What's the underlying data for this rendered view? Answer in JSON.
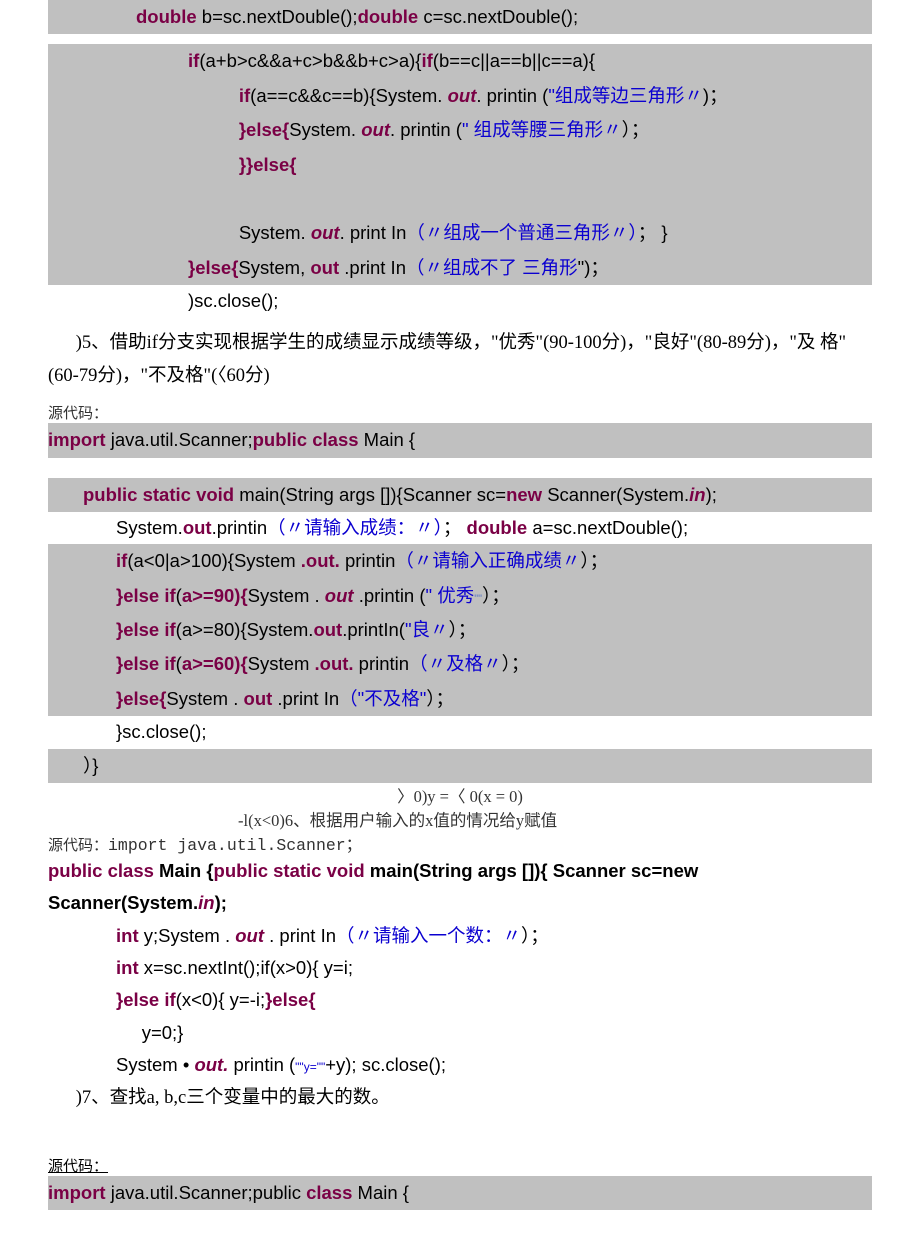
{
  "b1": {
    "l1_a": "double ",
    "l1_b": "b=sc.nextDouble();",
    "l1_c": "double ",
    "l1_d": "c=sc.nextDouble();",
    "l2_a": "if",
    "l2_b": "(a+b>c&&a+c>b&&b+c>a){",
    "l2_c": "if",
    "l2_d": "(b==c||a==b||c==a){",
    "l3_a": "if",
    "l3_b": "(a==c&&c==b){System. ",
    "l3_c": "out",
    "l3_d": ". printin (",
    "l3_e": "\"组成等边三角形〃",
    "l3_f": ")；",
    "l4_a": "}else{",
    "l4_b": "System. ",
    "l4_c": "out",
    "l4_d": ". printin (",
    "l4_e": "\" 组成等腰三角形〃",
    "l4_f": "）；",
    "l5": "}}",
    "l5b": "else{",
    "l6_a": "System. ",
    "l6_b": "out",
    "l6_c": ". print In",
    "l6_d": "（〃组成一个普通三角形〃）",
    "l6_e": "；  }",
    "l7_a": "}else{",
    "l7_b": "System, ",
    "l7_c": "out ",
    "l7_d": ".print In",
    "l7_e": "（〃组成不了  三角形",
    "l7_f": "\")；",
    "l8": ")sc.close();"
  },
  "p5": "      )5、借助if分支实现根据学生的成绩显示成绩等级，\"优秀\"(90-100分)，\"良好\"(80-89分)，\"及 格\"(60-79分)，\"不及格\"(〈60分)",
  "src": "源代码：",
  "b2": {
    "l1_a": "import ",
    "l1_b": "java.util.Scanner;",
    "l1_c": "public class ",
    "l1_d": "Main {",
    "l2_a": "public static void ",
    "l2_b": "main(String args []){Scanner ",
    "l2_c": "sc",
    "l2_d": "=",
    "l2_e": "new ",
    "l2_f": "Scanner(System.",
    "l2_g": "in",
    "l2_h": ");",
    "l3_a": "System.",
    "l3_b": "out",
    "l3_c": ".printin",
    "l3_d": "（〃请输入成绩：〃）",
    "l3_e": "；  ",
    "l3_f": "double ",
    "l3_g": "a=sc.nextDouble();",
    "l4_a": "if",
    "l4_b": "(a<0|a>100){System ",
    "l4_c": ".out.",
    "l4_d": " printin",
    "l4_e": "（〃请输入正确成绩〃",
    "l4_f": "）；",
    "l5_a": "}else if",
    "l5_b": "(",
    "l5_c": "a>=90){",
    "l5_d": "System . ",
    "l5_e": "out ",
    "l5_f": ".printin (",
    "l5_g": "\" 优秀",
    "l5_h": "\"\"",
    "l5_i": "）；",
    "l6_a": "}else if",
    "l6_b": "(a>=80){System.",
    "l6_c": "out",
    "l6_d": ".printIn(",
    "l6_e": "\"良〃",
    "l6_f": "）；",
    "l7_a": "}else if",
    "l7_b": "(",
    "l7_c": "a>=60){",
    "l7_d": "System ",
    "l7_e": ".out.",
    "l7_f": " printin",
    "l7_g": "（〃及格〃",
    "l7_h": "）；",
    "l8_a": "}else{",
    "l8_b": "System . ",
    "l8_c": "out ",
    "l8_d": ".print In",
    "l8_e": "（\"不及格\"",
    "l8_f": "）；",
    "l9": "}sc.close();",
    "l10": "）}"
  },
  "mid1": "〉0)y =〈 0(x = 0)",
  "mid2": "-l(x<0)6、根据用户输入的x值的情况给y赋值",
  "src2": "源代码：",
  "imp2": "import  java.util.Scanner；",
  "b3": {
    "l1_a": "public class ",
    "l1_b": "Main {",
    "l1_c": "public static void ",
    "l1_d": "main(String args []){ Scanner sc=new Scanner(System.",
    "l1_e": "in",
    "l1_f": ");",
    "l2_a": "int ",
    "l2_b": "y;System . ",
    "l2_c": "out",
    "l2_d": " . print In",
    "l2_e": "（〃请输入一个数：〃",
    "l2_f": "）；",
    "l3_a": "int ",
    "l3_b": "x=sc.nextInt();if(x>0){ y=i;",
    "l4_a": "}else if",
    "l4_b": "(x<0){ y=-i;",
    "l4_c": "}else{",
    "l5": "y=0;}",
    "l6_a": "System • ",
    "l6_b": "out.",
    "l6_c": " printin (",
    "l6_d": "\"\"y=\"\"",
    "l6_e": "+y); sc.close();"
  },
  "p7": "      )7、查找a, b,c三个变量中的最大的数。",
  "src3": "源代码：",
  "b4": {
    "l1_a": "import ",
    "l1_b": "java.util.Scanner;public ",
    "l1_c": "class ",
    "l1_d": "Main {"
  }
}
